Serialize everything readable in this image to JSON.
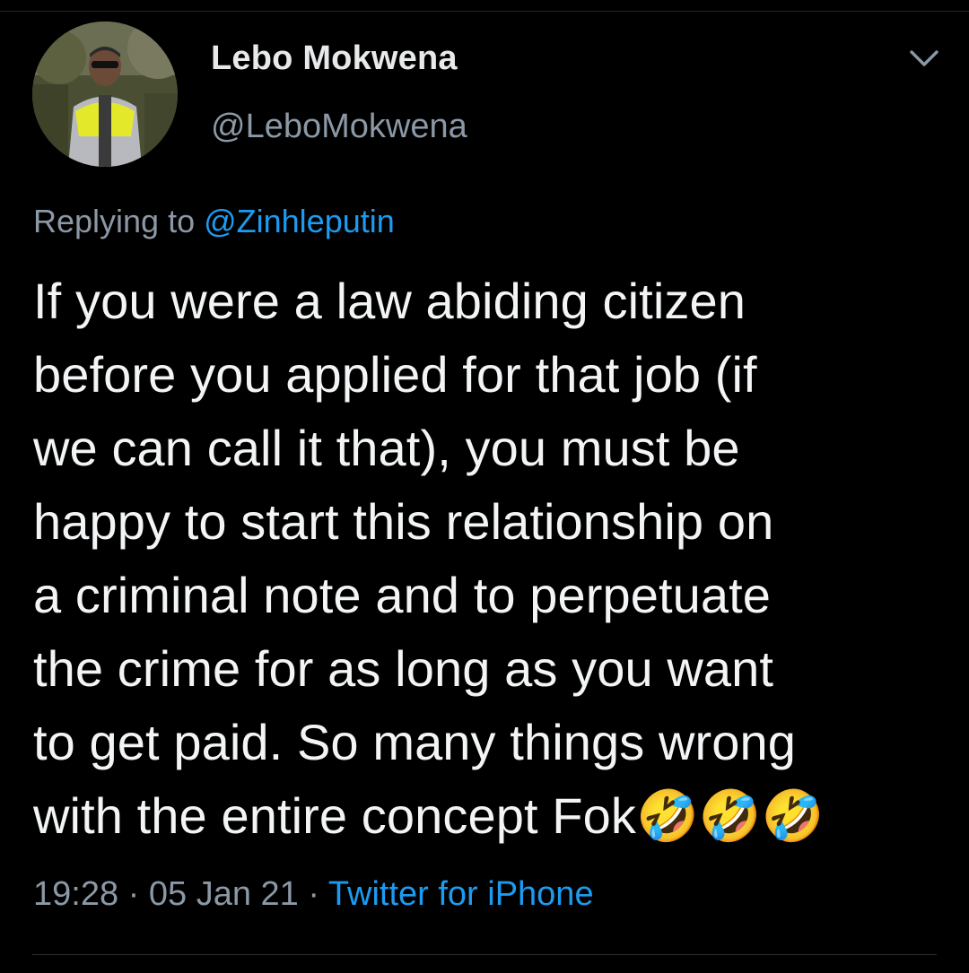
{
  "tweet": {
    "author": {
      "display_name": "Lebo Mokwena",
      "handle": "@LeboMokwena"
    },
    "reply": {
      "prefix": "Replying to ",
      "mention": "@Zinhleputin"
    },
    "text": "If you were a law abiding citizen\nbefore you applied for that job (if\nwe can call it that), you must be\nhappy to start this relationship on\na criminal note and to perpetuate\nthe crime for as long as you want\nto get paid. So many things wrong\nwith the entire concept Fok🤣🤣🤣",
    "meta": {
      "time": "19:28",
      "separator": " · ",
      "date": "05 Jan 21",
      "source": "Twitter for iPhone"
    }
  },
  "icons": {
    "menu": "chevron-down-icon"
  },
  "colors": {
    "background": "#000000",
    "text": "#e7e9ea",
    "secondary": "#8b98a5",
    "link": "#1d9bf0"
  }
}
